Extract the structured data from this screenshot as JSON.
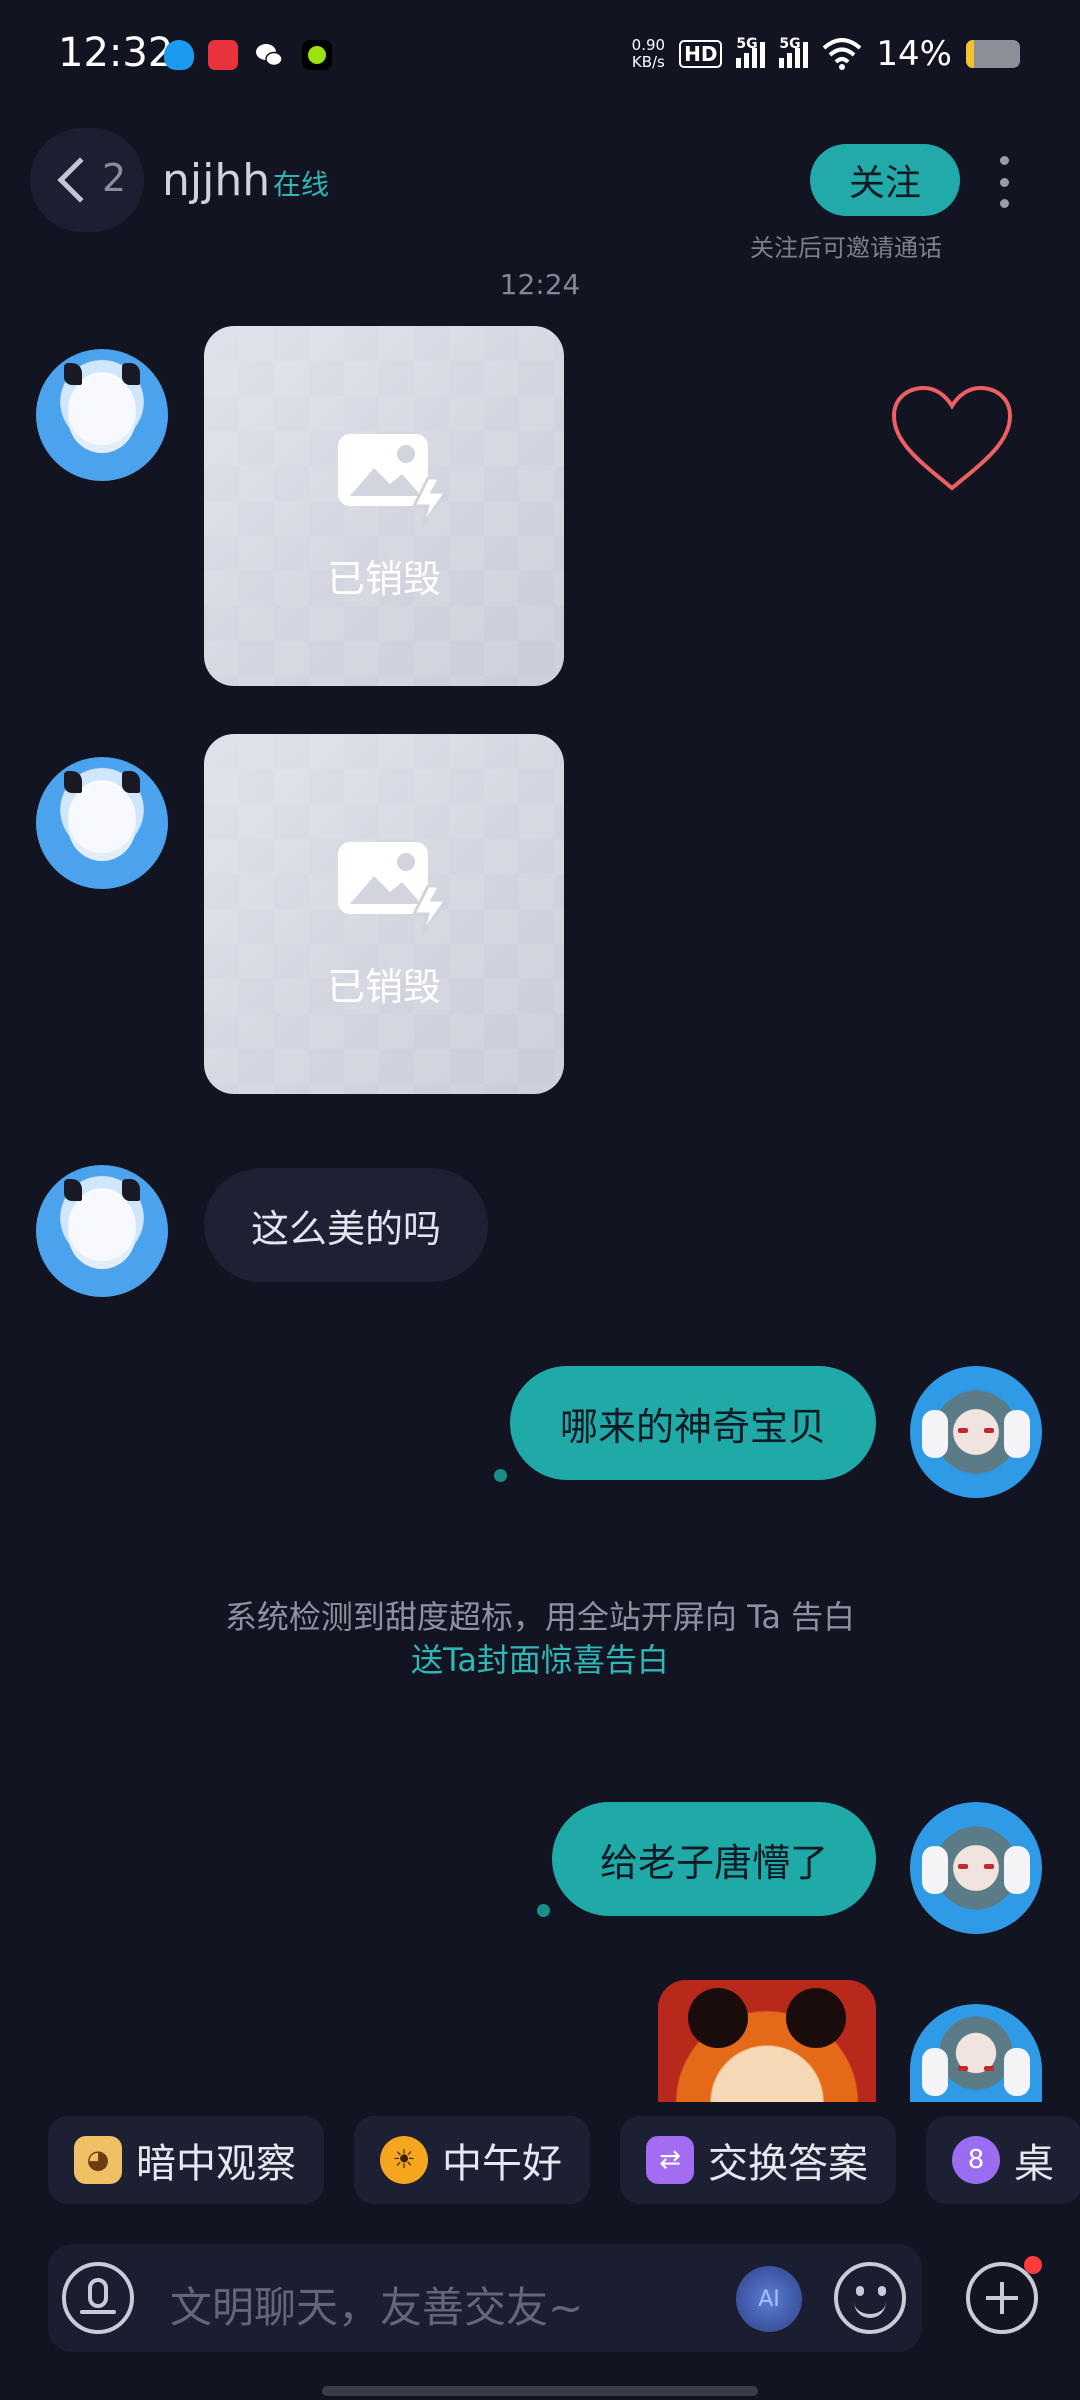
{
  "status_bar": {
    "time": "12:32",
    "net_speed_value": "0.90",
    "net_speed_unit": "KB/s",
    "hd_label": "HD",
    "sim1_label": "5G",
    "sim2_label": "5G",
    "battery_text": "14%",
    "battery_level": 0.14
  },
  "header": {
    "back_count": "2",
    "username": "njjhh",
    "status": "在线",
    "follow_label": "关注",
    "follow_hint": "关注后可邀请通话"
  },
  "chat": {
    "timestamp": "12:24",
    "destroyed_label_1": "已销毁",
    "destroyed_label_2": "已销毁",
    "msg_in_1": "这么美的吗",
    "msg_out_1": "哪来的神奇宝贝",
    "system_notice": "系统检测到甜度超标，用全站开屏向 Ta 告白",
    "system_link": "送Ta封面惊喜告白",
    "msg_out_2": "给老子唐懵了"
  },
  "quick_replies": [
    {
      "label": "暗中观察",
      "icon": "peek-icon"
    },
    {
      "label": "中午好",
      "icon": "sun-icon"
    },
    {
      "label": "交换答案",
      "icon": "swap-icon"
    },
    {
      "label": "桌",
      "icon": "billiard-8-icon"
    }
  ],
  "input_bar": {
    "placeholder": "文明聊天，友善交友~",
    "ai_label": "AI"
  },
  "colors": {
    "background": "#121422",
    "accent": "#1faaa8",
    "incoming_bubble": "#1e2133"
  }
}
